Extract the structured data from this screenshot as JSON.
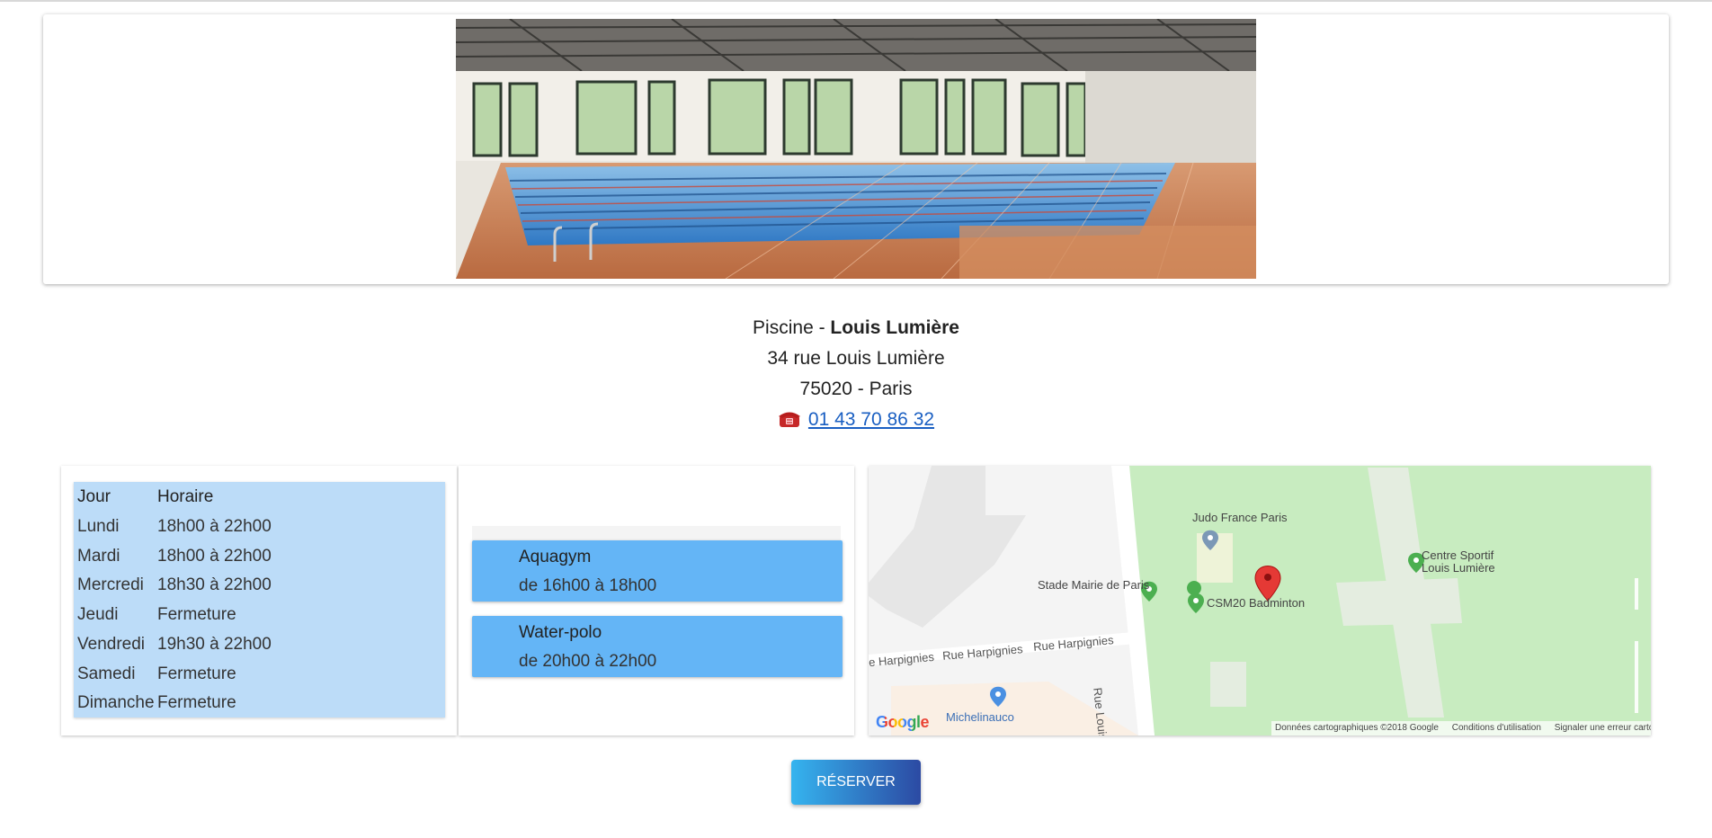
{
  "facility": {
    "type_prefix": "Piscine - ",
    "name": "Louis Lumière",
    "address": "34 rue Louis Lumière",
    "city": "75020 - Paris",
    "phone": "01 43 70 86 32",
    "phone_icon": "telephone-icon"
  },
  "hours": {
    "headers": {
      "day": "Jour",
      "time": "Horaire"
    },
    "rows": [
      {
        "day": "Lundi",
        "time": "18h00 à 22h00"
      },
      {
        "day": "Mardi",
        "time": "18h00 à 22h00"
      },
      {
        "day": "Mercredi",
        "time": "18h30 à 22h00"
      },
      {
        "day": "Jeudi",
        "time": "Fermeture"
      },
      {
        "day": "Vendredi",
        "time": "19h30 à 22h00"
      },
      {
        "day": "Samedi",
        "time": "Fermeture"
      },
      {
        "day": "Dimanche",
        "time": "Fermeture"
      }
    ]
  },
  "activities": [
    {
      "name": "Aquagym",
      "hours": "de 16h00 à 18h00"
    },
    {
      "name": "Water-polo",
      "hours": "de 20h00 à 22h00"
    }
  ],
  "map": {
    "places": {
      "judo": "Judo France Paris",
      "stade": "Stade Mairie de Paris",
      "csm": "CSM20 Badminton",
      "centre_line1": "Centre Sportif",
      "centre_line2": "Louis Lumière",
      "shop": "Michelinauco"
    },
    "streets": {
      "harp1": "e Harpignies",
      "harp2": "Rue Harpignies",
      "harp3": "Rue Harpignies",
      "lumiere": "Rue Louis Lumi"
    },
    "logo": "Google",
    "footer": {
      "data": "Données cartographiques ©2018 Google",
      "terms": "Conditions d'utilisation",
      "report": "Signaler une erreur cartog"
    },
    "colors": {
      "park": "#c8ecc0",
      "road": "#f6f6f6",
      "pin": "#e53935",
      "poi": "#4caf50"
    }
  },
  "actions": {
    "reserve": "RÉSERVER"
  },
  "colors": {
    "hours_bg": "#bcdcf8",
    "activity_bg": "#64b5f6",
    "link": "#1a5fc2"
  }
}
